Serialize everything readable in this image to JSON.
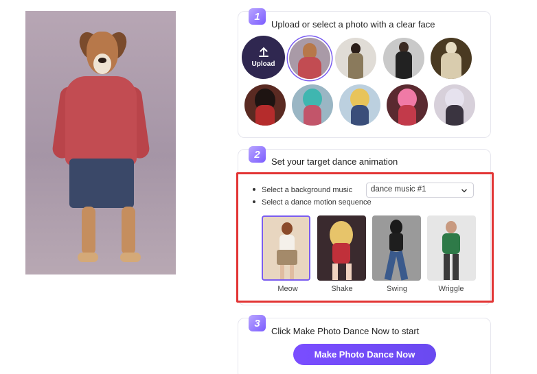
{
  "step1": {
    "number": "1",
    "title": "Upload or select a photo with a clear face",
    "upload_label": "Upload",
    "upload_icon": "upload-arrow-icon"
  },
  "step2": {
    "number": "2",
    "title": "Set your target dance animation",
    "music_label": "Select a background music",
    "music_value": "dance music #1",
    "motion_label": "Select a dance motion sequence",
    "motions": [
      "Meow",
      "Shake",
      "Swing",
      "Wriggle"
    ],
    "selected_motion": "Meow"
  },
  "step3": {
    "number": "3",
    "title": "Click Make Photo Dance Now to start",
    "cta_label": "Make Photo Dance Now"
  },
  "colors": {
    "accent": "#7a5cf0",
    "upload_bg": "#2f2750",
    "highlight": "#e23434"
  }
}
